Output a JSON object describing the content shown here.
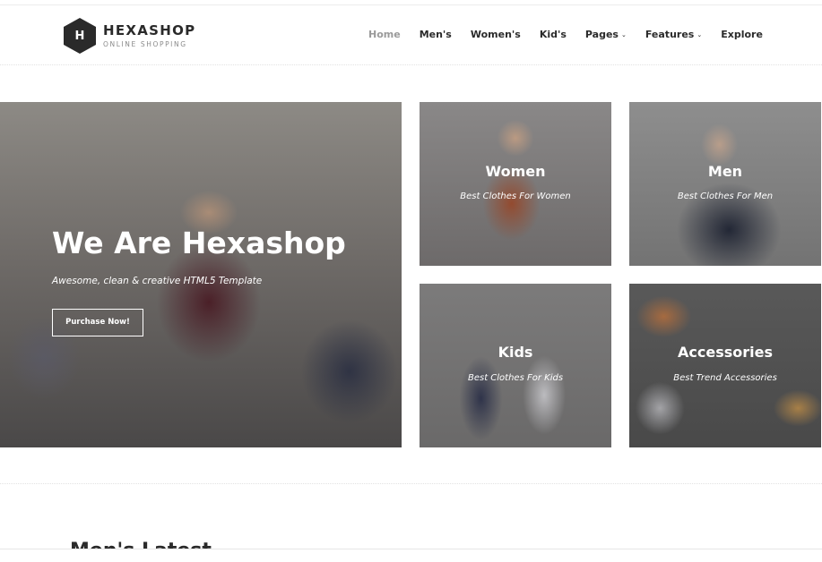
{
  "brand": {
    "name": "HEXASHOP",
    "tagline": "ONLINE SHOPPING",
    "mark": "H"
  },
  "nav": {
    "items": [
      {
        "label": "Home",
        "active": true
      },
      {
        "label": "Men's"
      },
      {
        "label": "Women's"
      },
      {
        "label": "Kid's"
      },
      {
        "label": "Pages",
        "dropdown": true
      },
      {
        "label": "Features",
        "dropdown": true
      },
      {
        "label": "Explore"
      }
    ],
    "caret": "⌄"
  },
  "hero": {
    "title": "We Are Hexashop",
    "subtitle": "Awesome, clean & creative HTML5 Template",
    "button": "Purchase Now!"
  },
  "categories": [
    {
      "title": "Women",
      "subtitle": "Best Clothes For Women"
    },
    {
      "title": "Men",
      "subtitle": "Best Clothes For Men"
    },
    {
      "title": "Kids",
      "subtitle": "Best Clothes For Kids"
    },
    {
      "title": "Accessories",
      "subtitle": "Best Trend Accessories"
    }
  ],
  "section": {
    "title": "Men's Latest"
  }
}
